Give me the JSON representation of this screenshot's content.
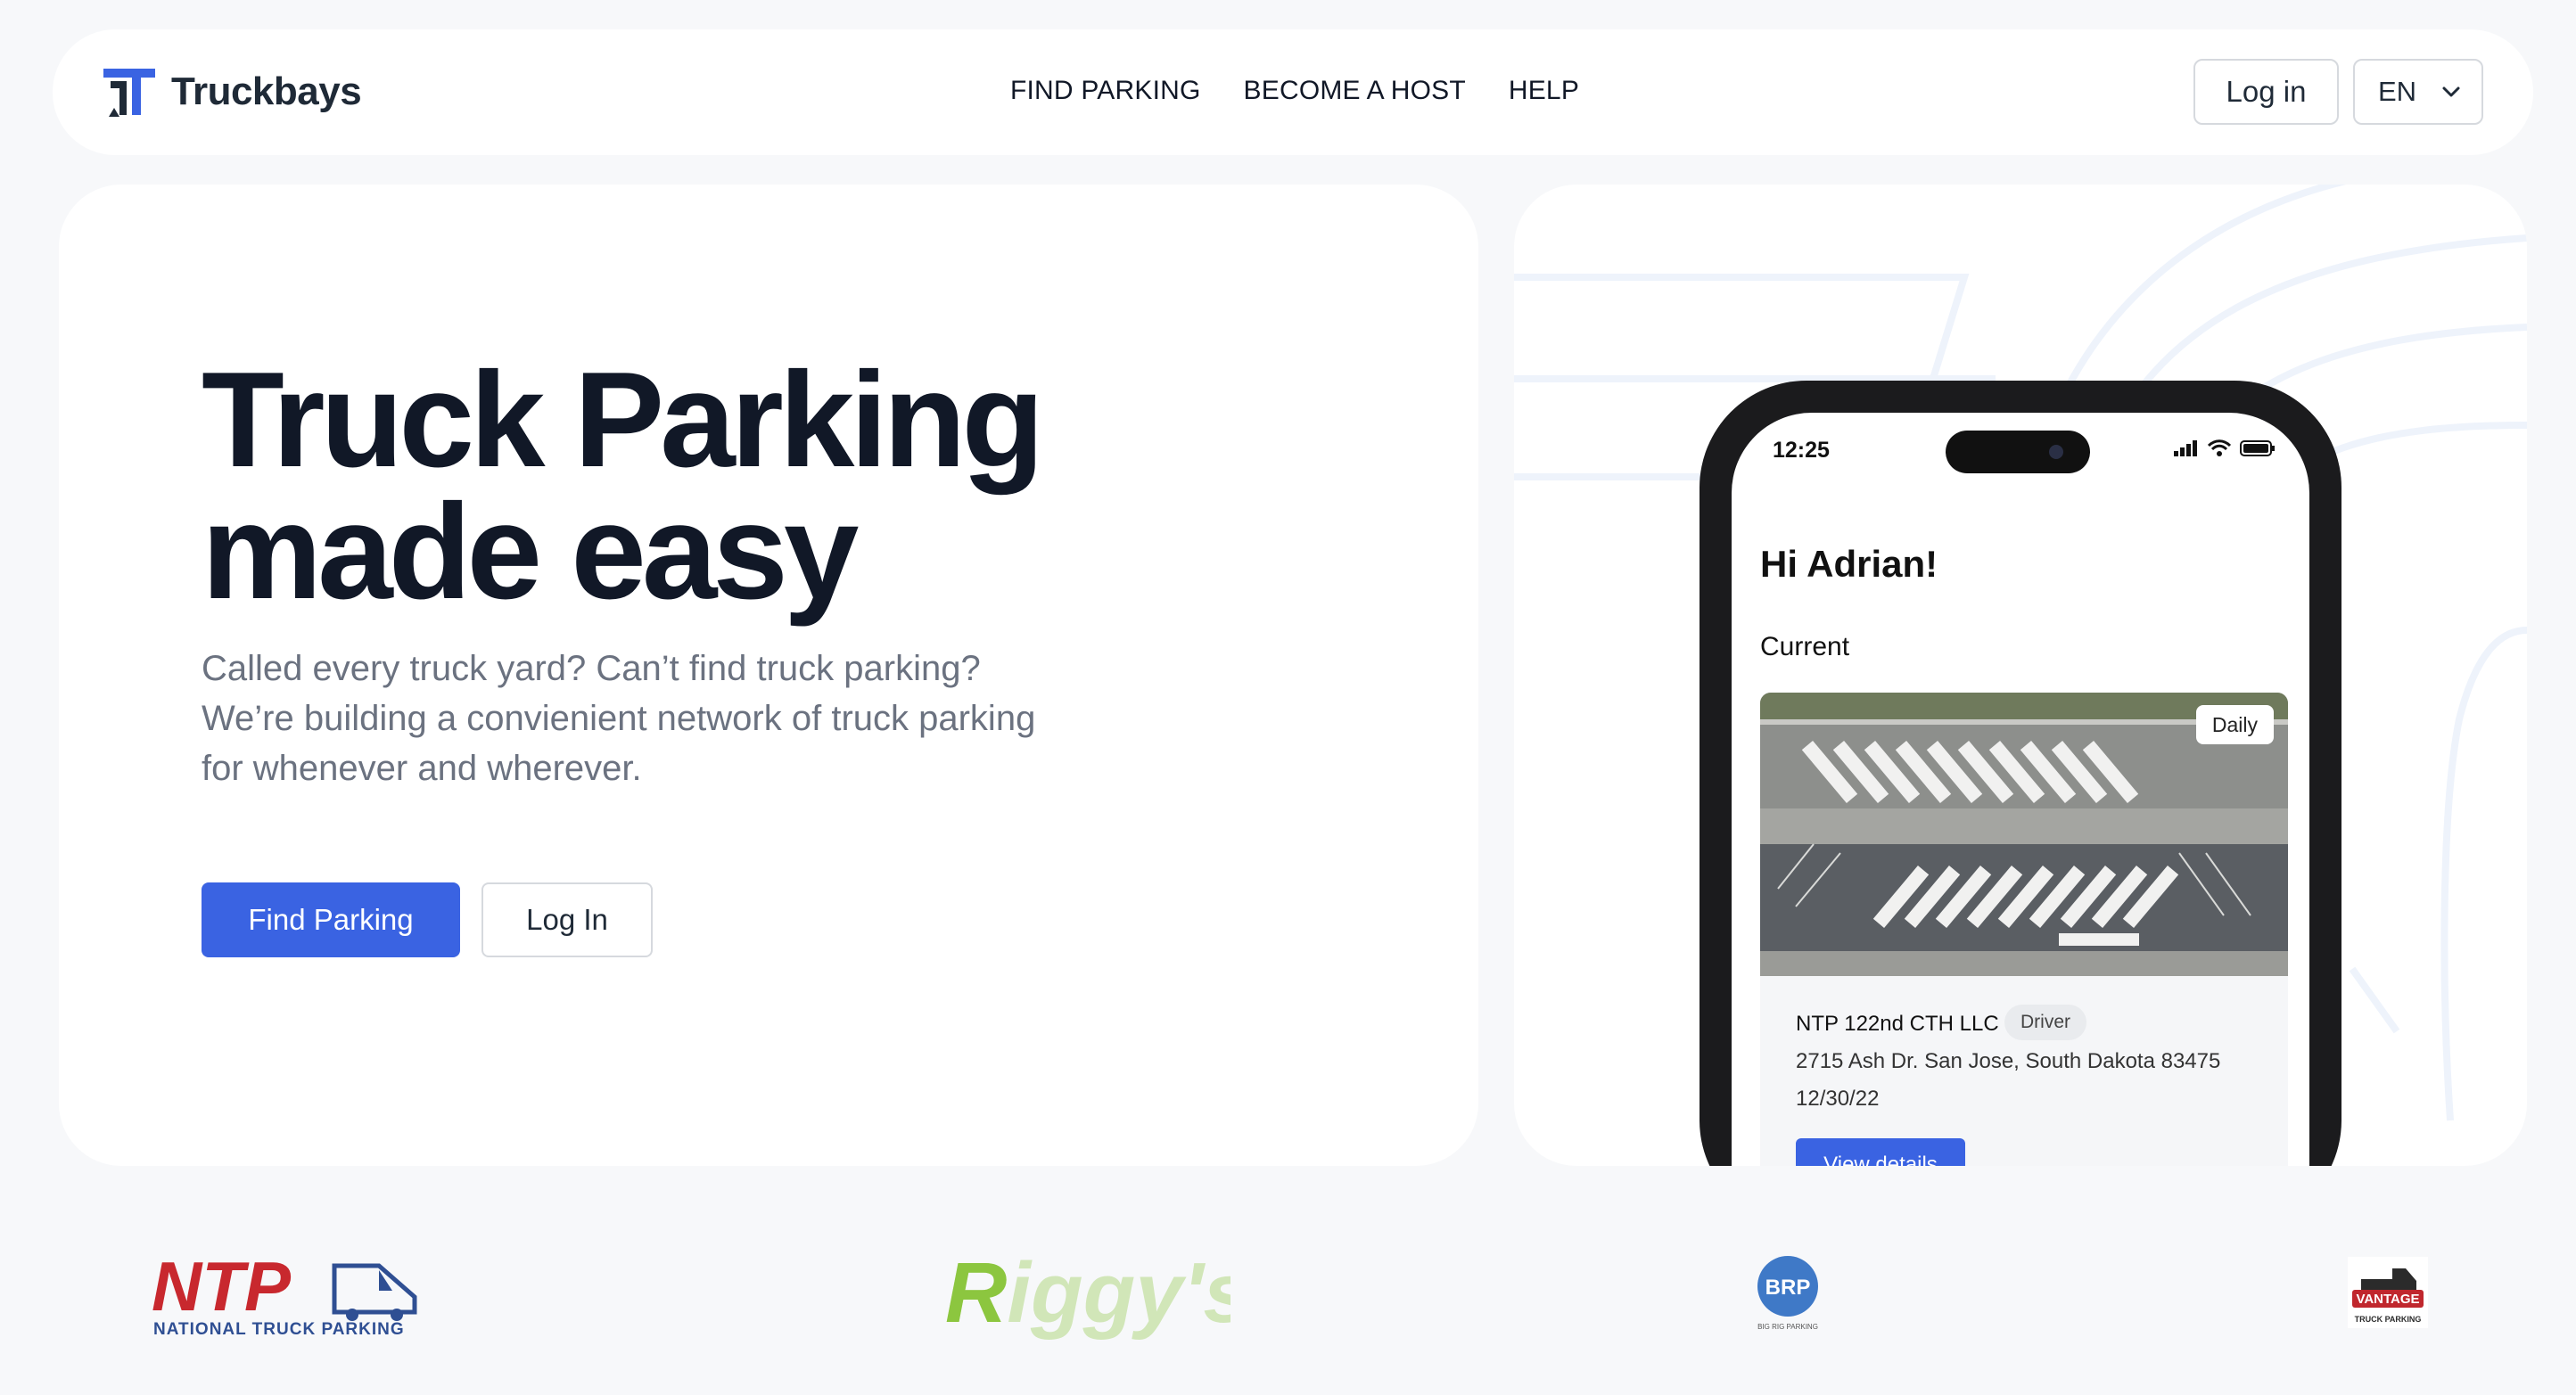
{
  "header": {
    "brand": "Truckbays",
    "nav": [
      "FIND PARKING",
      "BECOME A HOST",
      "HELP"
    ],
    "login_label": "Log in",
    "language": "EN"
  },
  "hero": {
    "title_line1": "Truck Parking",
    "title_line2": "made easy",
    "subtitle_line1": "Called every truck yard? Can’t find truck parking?",
    "subtitle_line2": "We’re building a convienient network of truck parking",
    "subtitle_line3": "for whenever and wherever.",
    "find_label": "Find Parking",
    "login_label": "Log In"
  },
  "phone": {
    "time": "12:25",
    "greeting": "Hi Adrian!",
    "section": "Current",
    "card": {
      "tag": "Daily",
      "name": "NTP 122nd CTH LLC",
      "role": "Driver",
      "address": "2715 Ash Dr. San Jose, South Dakota 83475",
      "date": "12/30/22",
      "button": "View details"
    }
  },
  "partners": {
    "ntp_main": "NTP",
    "ntp_sub": "NATIONAL TRUCK PARKING",
    "riggys": "Riggy's",
    "brp_mark": "BRP",
    "brp_sub": "BIG RIG PARKING",
    "vantage_main": "VANTAGE",
    "vantage_sub": "TRUCK PARKING"
  },
  "colors": {
    "accent": "#3a63e2",
    "text": "#111827",
    "muted": "#6b7280",
    "background": "#f7f8fa"
  }
}
